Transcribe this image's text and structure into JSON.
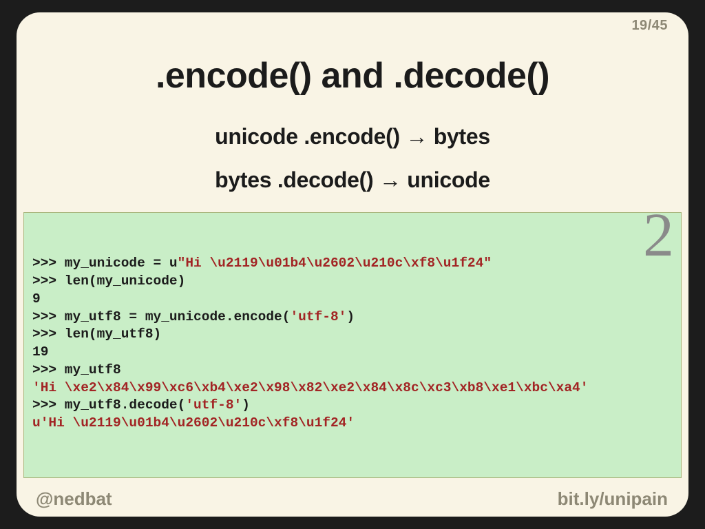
{
  "page": {
    "current": "19",
    "sep": "/",
    "total": "45"
  },
  "title": ".encode() and .decode()",
  "subtitle1": "unicode .encode() → bytes",
  "subtitle2": "bytes .decode() → unicode",
  "python_version_badge": "2",
  "code": {
    "l1_prompt": ">>> my_unicode = u",
    "l1_str": "\"Hi \\u2119\\u01b4\\u2602\\u210c\\xf8\\u1f24\"",
    "l2": ">>> len(my_unicode)",
    "l3": "9",
    "blank1": "",
    "l4_a": ">>> my_utf8 = my_unicode.encode(",
    "l4_str": "'utf-8'",
    "l4_b": ")",
    "l5": ">>> len(my_utf8)",
    "l6": "19",
    "l7": ">>> my_utf8",
    "l8_str": "'Hi \\xe2\\x84\\x99\\xc6\\xb4\\xe2\\x98\\x82\\xe2\\x84\\x8c\\xc3\\xb8\\xe1\\xbc\\xa4'",
    "blank2": "",
    "l9_a": ">>> my_utf8.decode(",
    "l9_str": "'utf-8'",
    "l9_b": ")",
    "l10_str": "u'Hi \\u2119\\u01b4\\u2602\\u210c\\xf8\\u1f24'"
  },
  "footer": {
    "left": "@nedbat",
    "right": "bit.ly/unipain"
  }
}
